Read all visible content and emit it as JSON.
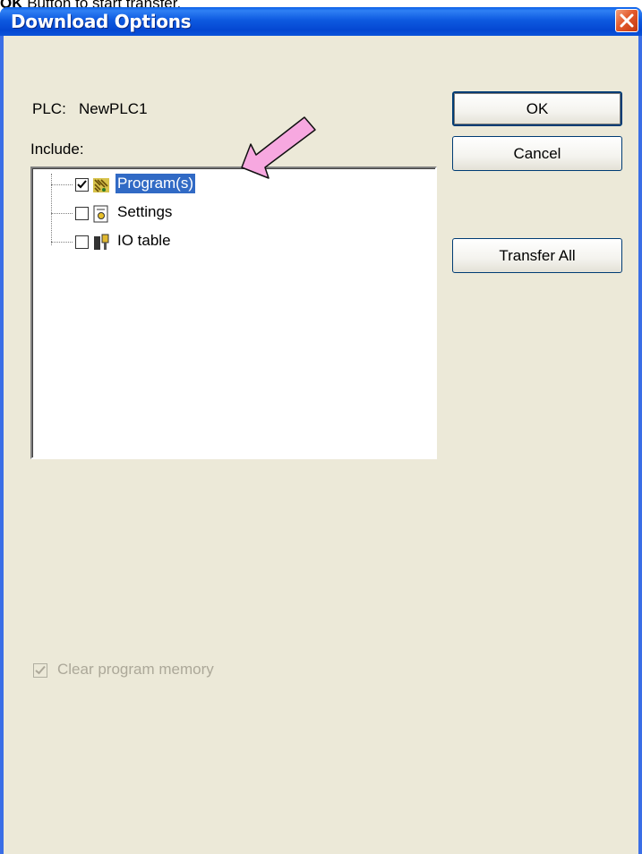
{
  "caption": {
    "bold": "OK",
    "rest": " Button to start transfer."
  },
  "window": {
    "title": "Download Options"
  },
  "plc": {
    "label": "PLC:",
    "name": "NewPLC1"
  },
  "include_label": "Include:",
  "tree_items": [
    {
      "label": "Program(s)",
      "checked": true,
      "selected": true,
      "icon": "program-icon"
    },
    {
      "label": "Settings",
      "checked": false,
      "selected": false,
      "icon": "settings-icon"
    },
    {
      "label": "IO table",
      "checked": false,
      "selected": false,
      "icon": "io-table-icon"
    }
  ],
  "buttons": {
    "ok": "OK",
    "cancel": "Cancel",
    "transfer_all": "Transfer All"
  },
  "clear_memory": {
    "label": "Clear program memory",
    "checked": true,
    "disabled": true
  },
  "colors": {
    "title_bar": "#0a5fe8",
    "client_bg": "#ece9d8",
    "selection": "#316ac5",
    "arrow": "#f7a8e0"
  }
}
